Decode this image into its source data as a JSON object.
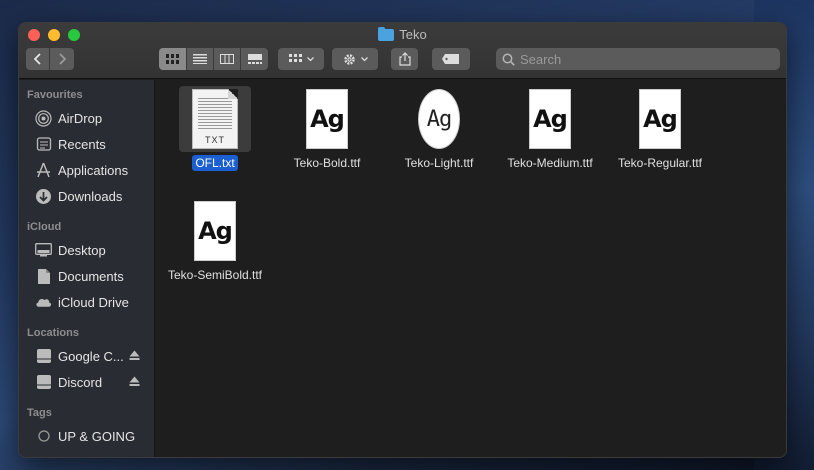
{
  "window": {
    "title": "Teko"
  },
  "toolbar": {
    "back_icon": "chevron-left-icon",
    "forward_icon": "chevron-right-icon",
    "search_placeholder": "Search"
  },
  "sidebar": {
    "sections": [
      {
        "title": "Favourites",
        "items": [
          {
            "label": "AirDrop",
            "icon": "airdrop-icon"
          },
          {
            "label": "Recents",
            "icon": "clock-icon"
          },
          {
            "label": "Applications",
            "icon": "applications-icon"
          },
          {
            "label": "Downloads",
            "icon": "download-icon"
          }
        ]
      },
      {
        "title": "iCloud",
        "items": [
          {
            "label": "Desktop",
            "icon": "desktop-icon"
          },
          {
            "label": "Documents",
            "icon": "document-icon"
          },
          {
            "label": "iCloud Drive",
            "icon": "cloud-icon"
          }
        ]
      },
      {
        "title": "Locations",
        "items": [
          {
            "label": "Google C...",
            "icon": "drive-icon",
            "eject": true
          },
          {
            "label": "Discord",
            "icon": "drive-icon",
            "eject": true
          }
        ]
      },
      {
        "title": "Tags",
        "items": [
          {
            "label": "UP & GOING",
            "icon": "tag-circle-icon"
          }
        ]
      }
    ]
  },
  "files": [
    {
      "name": "OFL.txt",
      "kind": "text",
      "ext": "TXT",
      "selected": true
    },
    {
      "name": "Teko-Bold.ttf",
      "kind": "font",
      "preview": "Ag",
      "weight": "bold"
    },
    {
      "name": "Teko-Light.ttf",
      "kind": "font",
      "preview": "Ag",
      "weight": "light"
    },
    {
      "name": "Teko-Medium.ttf",
      "kind": "font",
      "preview": "Ag",
      "weight": "bold"
    },
    {
      "name": "Teko-Regular.ttf",
      "kind": "font",
      "preview": "Ag",
      "weight": "bold"
    },
    {
      "name": "Teko-SemiBold.ttf",
      "kind": "font",
      "preview": "Ag",
      "weight": "bold"
    }
  ],
  "colors": {
    "selection": "#1b5fd1",
    "folder": "#4aa3df"
  }
}
